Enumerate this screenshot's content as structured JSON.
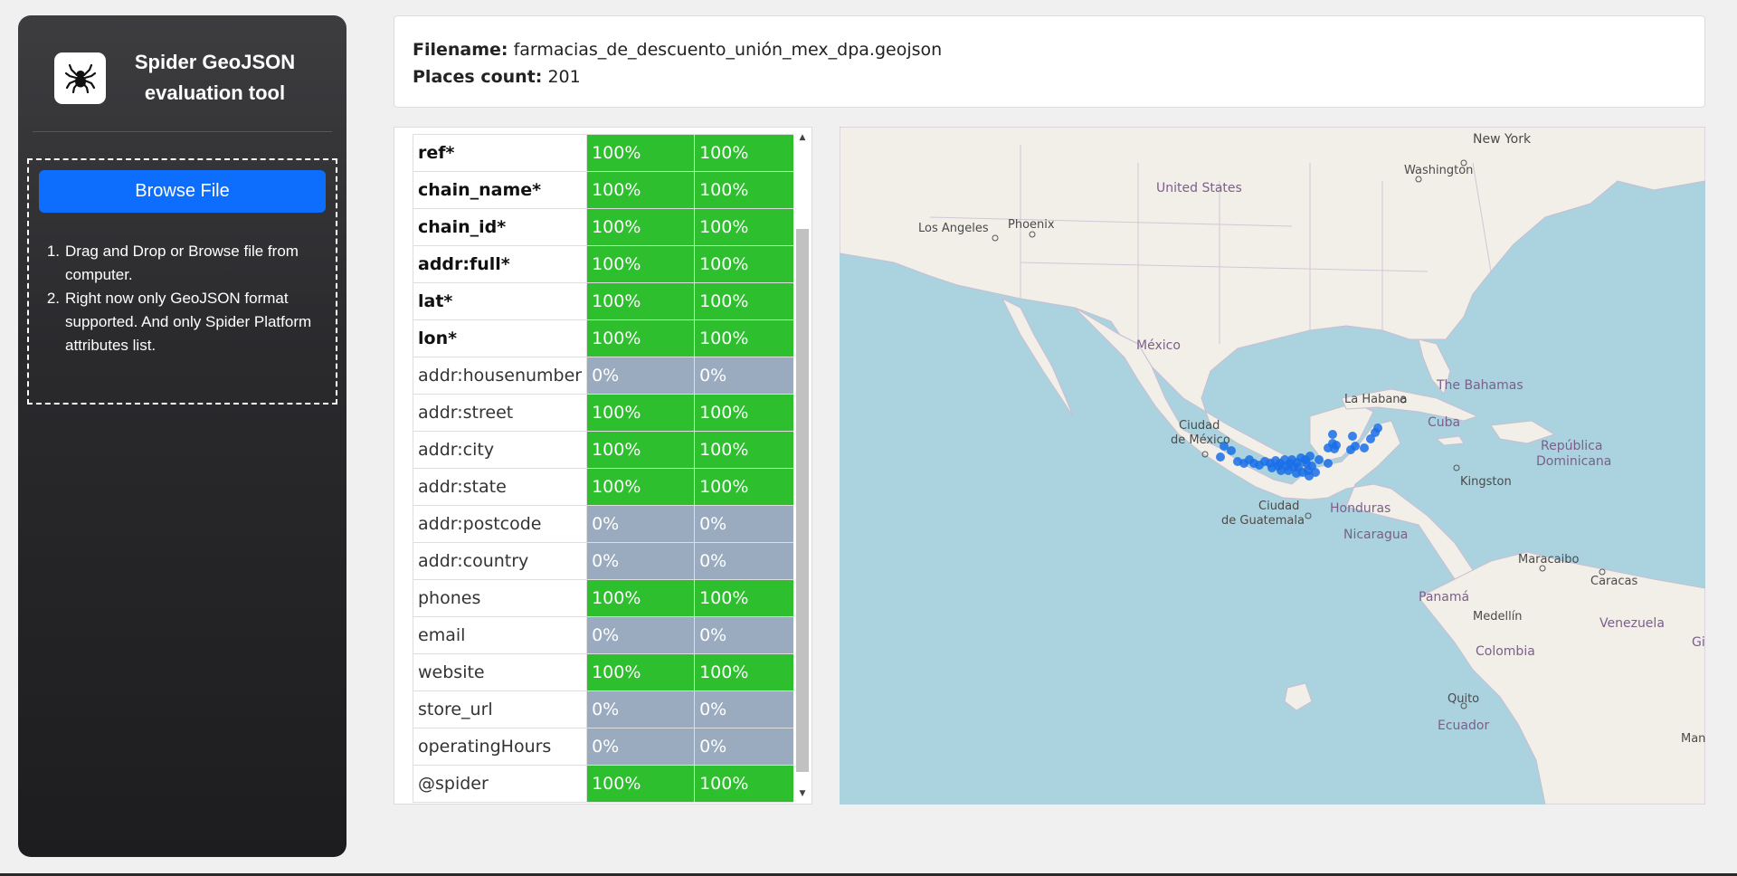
{
  "sidebar": {
    "title": "Spider GeoJSON evaluation tool",
    "logo_icon": "spider-icon",
    "browse_label": "Browse File",
    "instructions": [
      {
        "num": "1.",
        "text": "Drag and Drop or Browse file from computer."
      },
      {
        "num": "2.",
        "text": "Right now only GeoJSON format supported. And only Spider Platform attributes list."
      }
    ]
  },
  "info": {
    "filename_label": "Filename:",
    "filename": "farmacias_de_descuento_unión_mex_dpa.geojson",
    "count_label": "Places count:",
    "count": "201"
  },
  "table": {
    "rows": [
      {
        "name": "ref*",
        "required": true,
        "a": "100%",
        "b": "100%"
      },
      {
        "name": "chain_name*",
        "required": true,
        "a": "100%",
        "b": "100%"
      },
      {
        "name": "chain_id*",
        "required": true,
        "a": "100%",
        "b": "100%"
      },
      {
        "name": "addr:full*",
        "required": true,
        "a": "100%",
        "b": "100%"
      },
      {
        "name": "lat*",
        "required": true,
        "a": "100%",
        "b": "100%"
      },
      {
        "name": "lon*",
        "required": true,
        "a": "100%",
        "b": "100%"
      },
      {
        "name": "addr:housenumber",
        "required": false,
        "a": "0%",
        "b": "0%"
      },
      {
        "name": "addr:street",
        "required": false,
        "a": "100%",
        "b": "100%"
      },
      {
        "name": "addr:city",
        "required": false,
        "a": "100%",
        "b": "100%"
      },
      {
        "name": "addr:state",
        "required": false,
        "a": "100%",
        "b": "100%"
      },
      {
        "name": "addr:postcode",
        "required": false,
        "a": "0%",
        "b": "0%"
      },
      {
        "name": "addr:country",
        "required": false,
        "a": "0%",
        "b": "0%"
      },
      {
        "name": "phones",
        "required": false,
        "a": "100%",
        "b": "100%"
      },
      {
        "name": "email",
        "required": false,
        "a": "0%",
        "b": "0%"
      },
      {
        "name": "website",
        "required": false,
        "a": "100%",
        "b": "100%"
      },
      {
        "name": "store_url",
        "required": false,
        "a": "0%",
        "b": "0%"
      },
      {
        "name": "operatingHours",
        "required": false,
        "a": "0%",
        "b": "0%"
      },
      {
        "name": "@spider",
        "required": false,
        "a": "100%",
        "b": "100%"
      }
    ],
    "colors": {
      "full": "#2dbf2d",
      "zero": "#9aabbf"
    }
  },
  "map": {
    "labels": {
      "new_york": "New York",
      "washington": "Washington",
      "united_states": "United States",
      "los_angeles": "Los Angeles",
      "phoenix": "Phoenix",
      "mexico": "México",
      "ciudad_de_mexico_1": "Ciudad",
      "ciudad_de_mexico_2": "de México",
      "la_habana": "La Habana",
      "bahamas": "The Bahamas",
      "cuba": "Cuba",
      "republica_1": "República",
      "republica_2": "Dominicana",
      "kingston": "Kingston",
      "honduras": "Honduras",
      "guatemala_1": "Ciudad",
      "guatemala_2": "de Guatemala",
      "nicaragua": "Nicaragua",
      "maracaibo": "Maracaibo",
      "caracas": "Caracas",
      "panama": "Panamá",
      "medellin": "Medellín",
      "venezuela": "Venezuela",
      "colombia": "Colombia",
      "quito": "Quito",
      "ecuador": "Ecuador",
      "gi": "Gi",
      "man": "Man"
    },
    "marker_color": "#1a6fe8"
  }
}
